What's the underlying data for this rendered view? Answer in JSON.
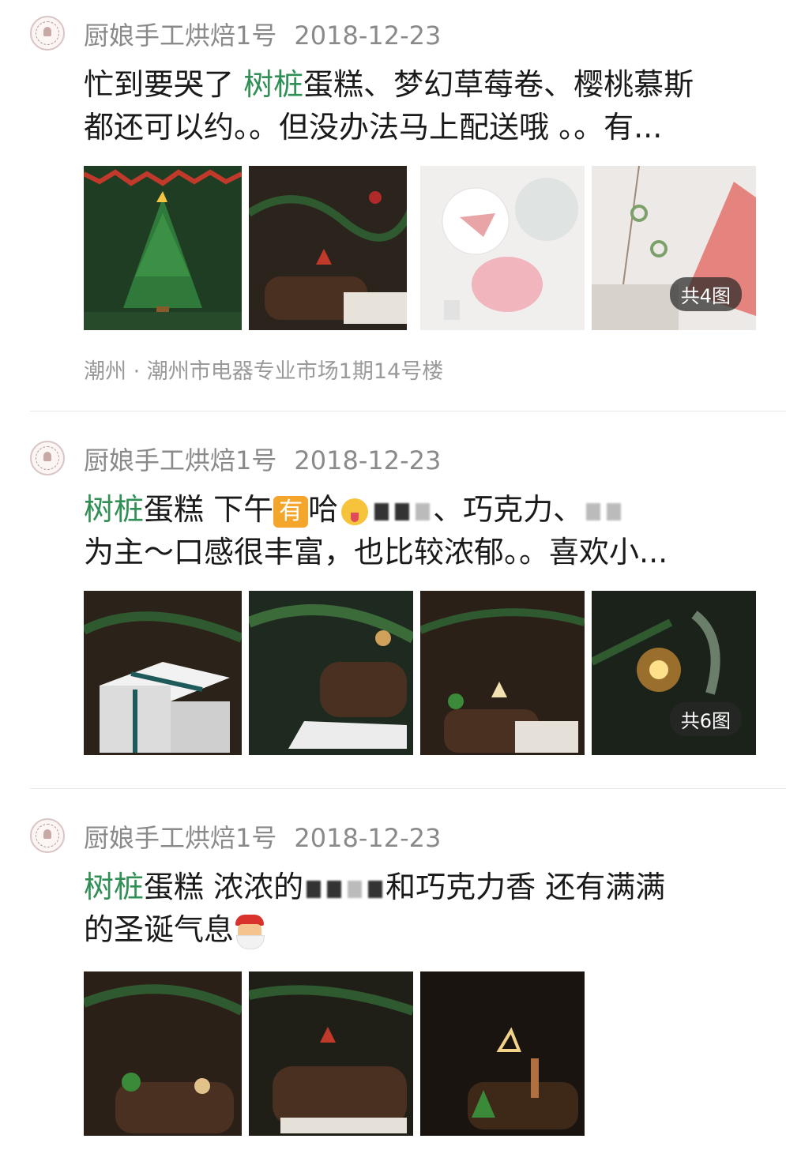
{
  "posts": [
    {
      "author": "厨娘手工烘焙1号",
      "date": "2018-12-23",
      "tag": "树桩",
      "line1_rest": "蛋糕、梦幻草莓卷、樱桃慕斯",
      "line1_prefix": "忙到要哭了 ",
      "line2": "都还可以约。。但没办法马上配送哦 。。有...",
      "location": "潮州 · 潮州市电器专业市场1期14号楼",
      "badge": "共4图"
    },
    {
      "author": "厨娘手工烘焙1号",
      "date": "2018-12-23",
      "tag": "树桩",
      "line1_a": "蛋糕 下午",
      "emoji_you": "有",
      "line1_b": "哈",
      "line1_c": "、巧克力、",
      "line2": "为主～口感很丰富，也比较浓郁。。喜欢小...",
      "badge": "共6图"
    },
    {
      "author": "厨娘手工烘焙1号",
      "date": "2018-12-23",
      "tag": "树桩",
      "line1_a": "蛋糕 浓浓的",
      "line1_b": "和巧克力香 还有满满",
      "line2": "的圣诞气息"
    }
  ],
  "avatar_icon": "bakery-logo-icon",
  "colors": {
    "tag_green": "#2f8f55",
    "meta_gray": "#8a8a8a",
    "divider": "#e8e8e8"
  }
}
